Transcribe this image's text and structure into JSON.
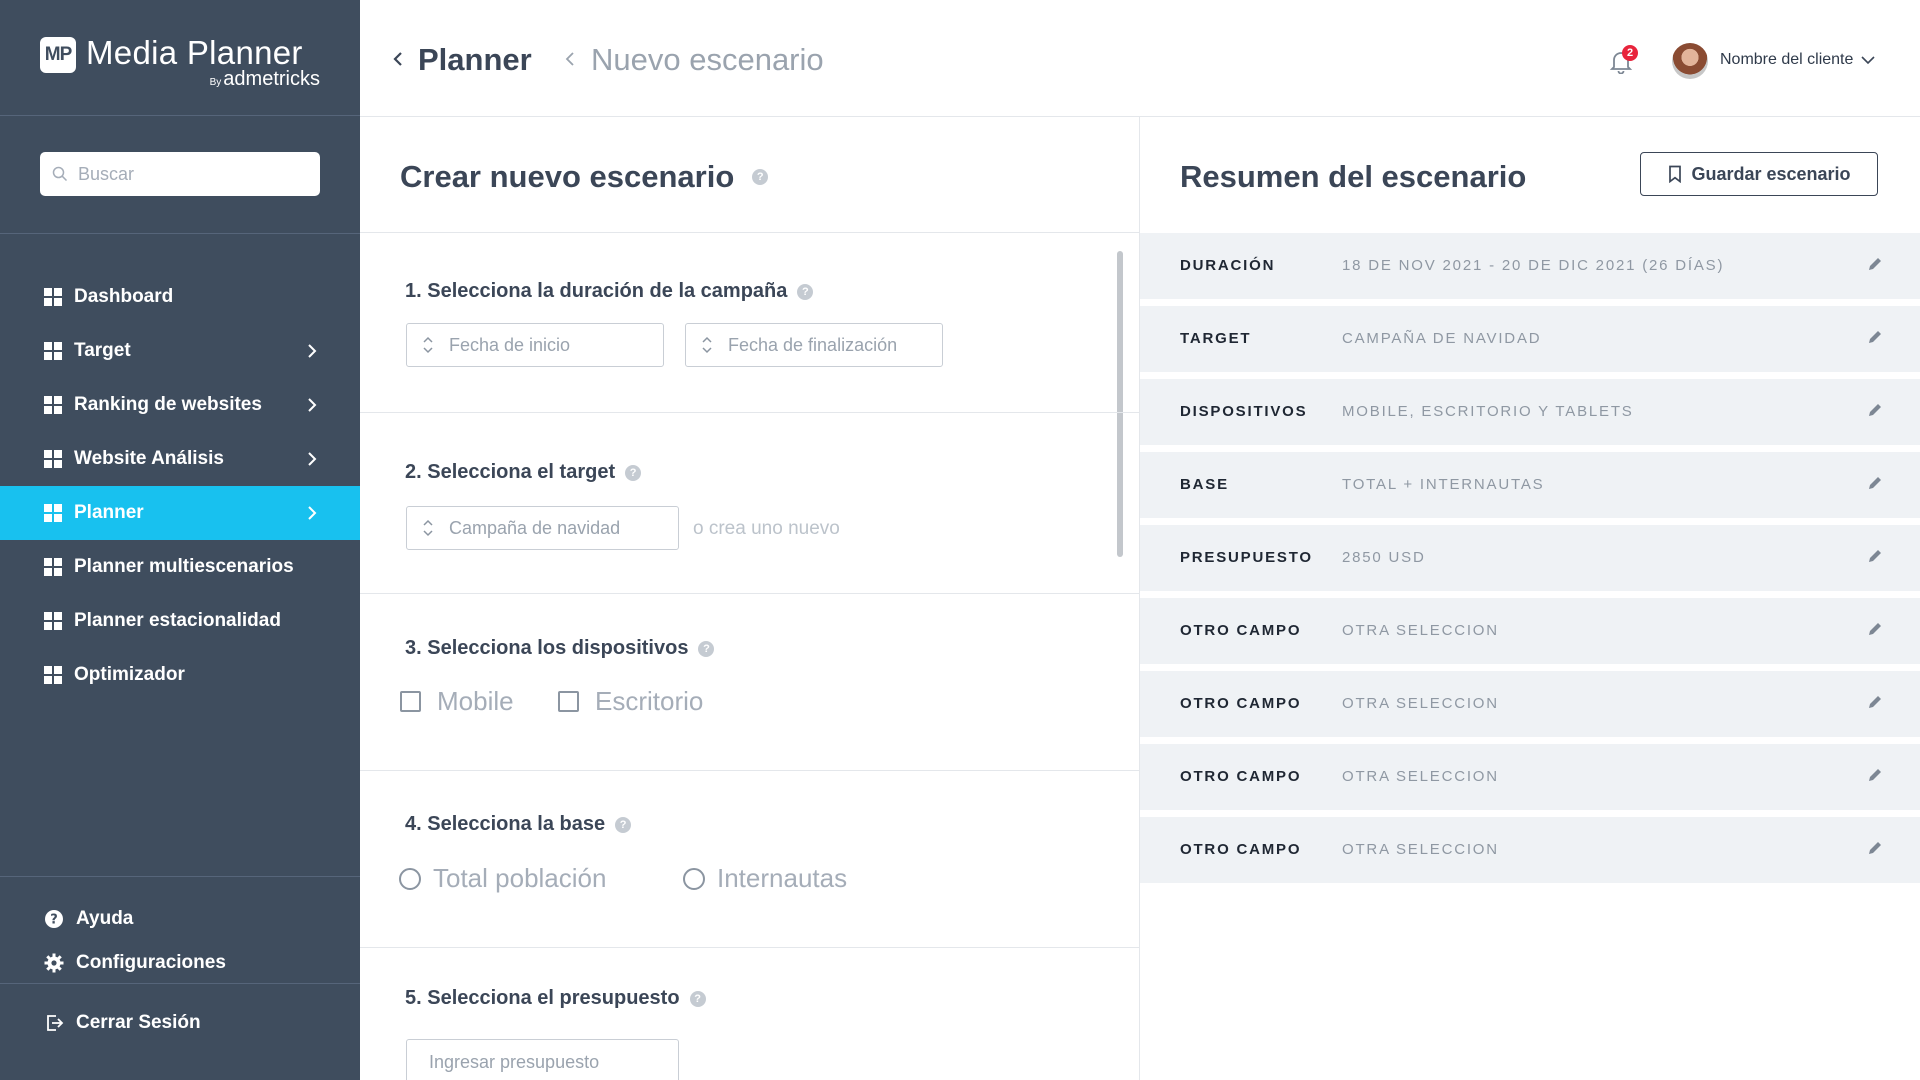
{
  "brand": {
    "mark": "MP",
    "title": "Media Planner",
    "by": "By",
    "sub": "admetricks"
  },
  "search": {
    "placeholder": "Buscar"
  },
  "nav": [
    {
      "label": "Dashboard",
      "chevron": false,
      "active": false
    },
    {
      "label": "Target",
      "chevron": true,
      "active": false
    },
    {
      "label": "Ranking de websites",
      "chevron": true,
      "active": false
    },
    {
      "label": "Website Análisis",
      "chevron": true,
      "active": false
    },
    {
      "label": "Planner",
      "chevron": true,
      "active": true
    },
    {
      "label": "Planner multiescenarios",
      "chevron": false,
      "active": false
    },
    {
      "label": "Planner estacionalidad",
      "chevron": false,
      "active": false
    },
    {
      "label": "Optimizador",
      "chevron": false,
      "active": false
    }
  ],
  "bottom_nav": {
    "help": "Ayuda",
    "settings": "Configuraciones",
    "logout": "Cerrar Sesión"
  },
  "header": {
    "parent": "Planner",
    "current": "Nuevo escenario",
    "notifications": "2",
    "user_name": "Nombre del cliente"
  },
  "form": {
    "title": "Crear nuevo escenario",
    "help_glyph": "?",
    "s1": {
      "title": "1. Selecciona la duración de la campaña",
      "start_placeholder": "Fecha de inicio",
      "end_placeholder": "Fecha de finalización"
    },
    "s2": {
      "title": "2. Selecciona el target",
      "value": "Campaña de navidad",
      "create_link": "o crea uno nuevo"
    },
    "s3": {
      "title": "3. Selecciona los dispositivos",
      "options": [
        "Mobile",
        "Escritorio"
      ]
    },
    "s4": {
      "title": "4. Selecciona la base",
      "options": [
        "Total población",
        "Internautas"
      ]
    },
    "s5": {
      "title": "5. Selecciona el presupuesto",
      "placeholder": "Ingresar presupuesto"
    }
  },
  "summary": {
    "title": "Resumen del escenario",
    "save_label": "Guardar escenario",
    "rows": [
      {
        "label": "DURACIÓN",
        "value": "18 DE NOV 2021 - 20 DE DIC 2021 (26 DÍAS)"
      },
      {
        "label": "TARGET",
        "value": "CAMPAÑA DE NAVIDAD"
      },
      {
        "label": "DISPOSITIVOS",
        "value": "MOBILE, ESCRITORIO Y TABLETS"
      },
      {
        "label": "BASE",
        "value": "TOTAL + INTERNAUTAS"
      },
      {
        "label": "PRESUPUESTO",
        "value": "2850 USD"
      },
      {
        "label": "OTRO CAMPO",
        "value": "OTRA SELECCION"
      },
      {
        "label": "OTRO CAMPO",
        "value": "OTRA SELECCION"
      },
      {
        "label": "OTRO CAMPO",
        "value": "OTRA SELECCION"
      },
      {
        "label": "OTRO CAMPO",
        "value": "OTRA SELECCION"
      }
    ]
  },
  "colors": {
    "sidebar": "#3f4d5e",
    "active": "#18c1ef",
    "badge": "#e8243c",
    "summary_row": "#eff2f5"
  }
}
